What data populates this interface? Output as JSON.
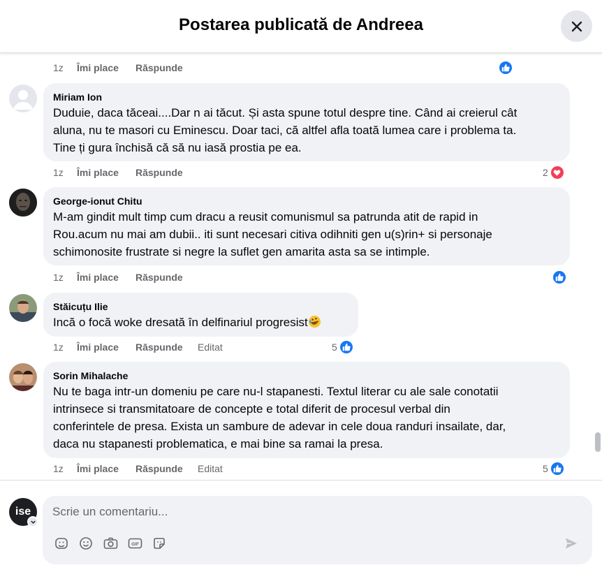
{
  "header": {
    "title": "Postarea publicată de Andreea"
  },
  "comments": [
    {
      "author": "",
      "time": "1z",
      "like": "Îmi place",
      "reply": "Răspunde",
      "reaction_count": ""
    },
    {
      "author": "Miriam Ion",
      "lines": [
        "Duduie, daca tăceai....Dar n ai tăcut. Și asta spune totul despre tine. Când ai creierul cât",
        "aluna, nu te masori cu Eminescu. Doar taci, că altfel afla toată lumea care i problema ta.",
        "Tine ți gura închisă că să nu iasă prostia pe ea."
      ],
      "time": "1z",
      "like": "Îmi place",
      "reply": "Răspunde",
      "reaction_count": "2"
    },
    {
      "author": "George-ionut Chitu",
      "lines": [
        "M-am gindit mult timp cum dracu a reusit comunismul sa patrunda atit de rapid in",
        "Rou.acum nu mai am dubii.. iti sunt necesari citiva odihniti gen u(s)rin+ si personaje",
        "schimonosite frustrate si negre la suflet gen amarita asta sa se intimple."
      ],
      "time": "1z",
      "like": "Îmi place",
      "reply": "Răspunde",
      "reaction_count": ""
    },
    {
      "author": "Stăicuțu Ilie",
      "lines": [
        "Incă o focă woke dresată în delfinariul progresist"
      ],
      "time": "1z",
      "like": "Îmi place",
      "reply": "Răspunde",
      "edited": "Editat",
      "reaction_count": "5"
    },
    {
      "author": "Sorin Mihalache",
      "lines": [
        "Nu te baga intr-un domeniu pe care nu-l stapanesti. Textul literar cu ale sale conotatii",
        "intrinsece si transmitatoare de concepte e total diferit de procesul verbal din",
        "conferintele de presa. Exista un sambure de adevar in cele doua randuri insailate, dar,",
        "daca nu stapanesti problematica, e mai bine sa ramai la presa."
      ],
      "time": "1z",
      "like": "Îmi place",
      "reply": "Răspunde",
      "edited": "Editat",
      "reaction_count": "5"
    }
  ],
  "composer": {
    "avatar_text": "ise",
    "placeholder": "Scrie un comentariu..."
  },
  "icons": [
    "close-icon",
    "like-reaction-icon",
    "love-reaction-icon",
    "rofl-emoji-icon",
    "sticker-icon",
    "emoji-icon",
    "camera-icon",
    "gif-icon",
    "avatar-sticker-icon",
    "send-icon",
    "chevron-down-icon"
  ],
  "colors": {
    "like_blue": "#1877f2",
    "love_red": "#f33e58",
    "bubble_bg": "#f0f2f5",
    "meta_gray": "#65676b"
  }
}
